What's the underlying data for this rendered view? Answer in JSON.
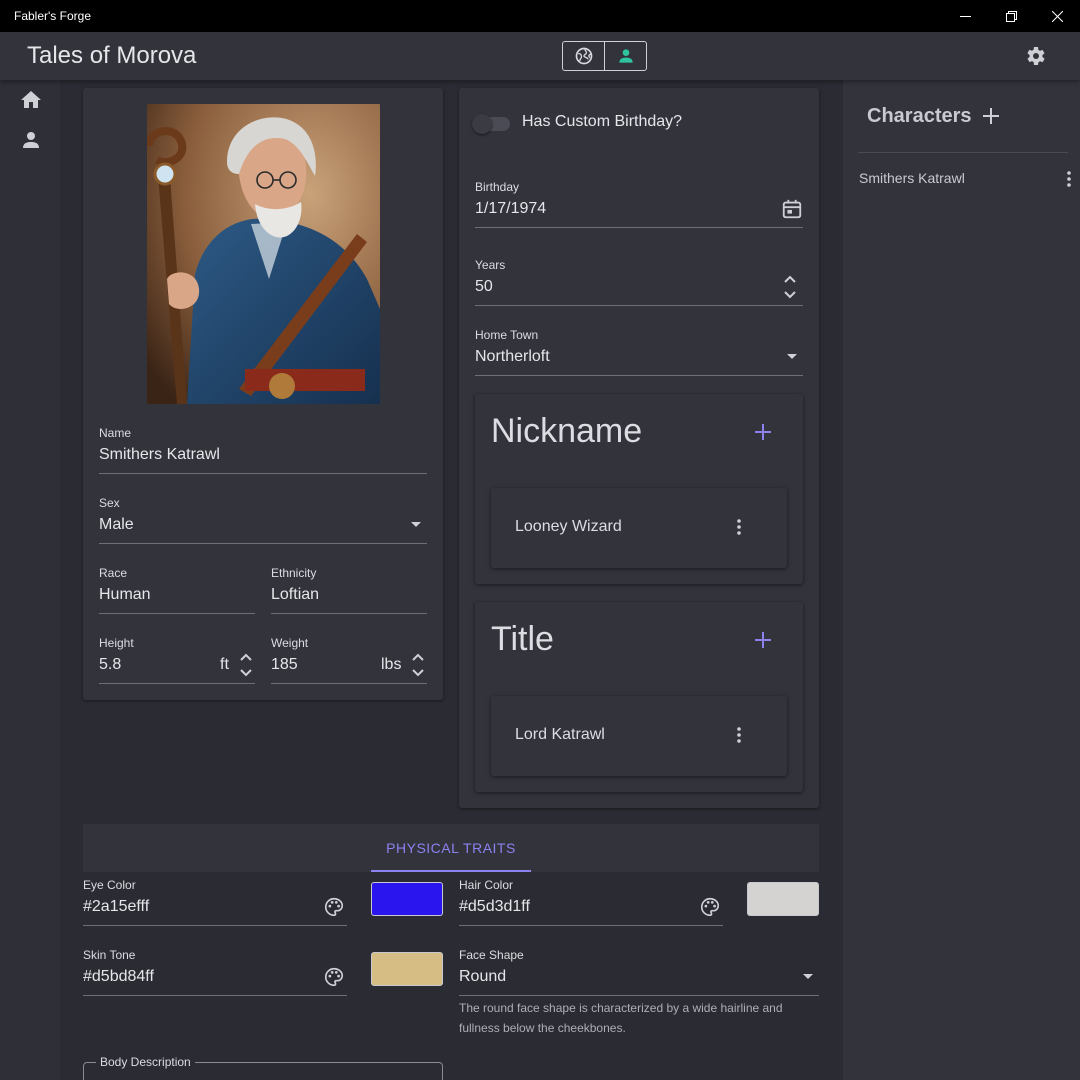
{
  "window": {
    "app_name": "Fabler's Forge"
  },
  "appbar": {
    "world_title": "Tales of Morova"
  },
  "colors": {
    "accent": "#8b82f0",
    "active_toggle": "#2ec4a0",
    "eye_swatch": "#2a15ef",
    "hair_swatch": "#d5d3d1",
    "skin_swatch": "#d5bd84"
  },
  "character": {
    "name_label": "Name",
    "name": "Smithers Katrawl",
    "sex_label": "Sex",
    "sex": "Male",
    "race_label": "Race",
    "race": "Human",
    "ethnicity_label": "Ethnicity",
    "ethnicity": "Loftian",
    "height_label": "Height",
    "height": "5.8",
    "height_unit": "ft",
    "weight_label": "Weight",
    "weight": "185",
    "weight_unit": "lbs"
  },
  "birth": {
    "custom_birthday_label": "Has Custom Birthday?",
    "birthday_label": "Birthday",
    "birthday": "1/17/1974",
    "years_label": "Years",
    "years": "50",
    "hometown_label": "Home Town",
    "hometown": "Northerloft"
  },
  "nickname": {
    "title": "Nickname",
    "items": [
      "Looney Wizard"
    ]
  },
  "titles": {
    "title": "Title",
    "items": [
      "Lord Katrawl"
    ]
  },
  "tabs": {
    "physical_traits": "PHYSICAL TRAITS"
  },
  "physical": {
    "eye_label": "Eye Color",
    "eye": "#2a15efff",
    "hair_label": "Hair Color",
    "hair": "#d5d3d1ff",
    "skin_label": "Skin Tone",
    "skin": "#d5bd84ff",
    "face_label": "Face Shape",
    "face": "Round",
    "face_description": "The round face shape is characterized by a wide hairline and fullness below the cheekbones.",
    "body_label": "Body Description"
  },
  "sidebar": {
    "title": "Characters",
    "items": [
      "Smithers Katrawl"
    ]
  }
}
